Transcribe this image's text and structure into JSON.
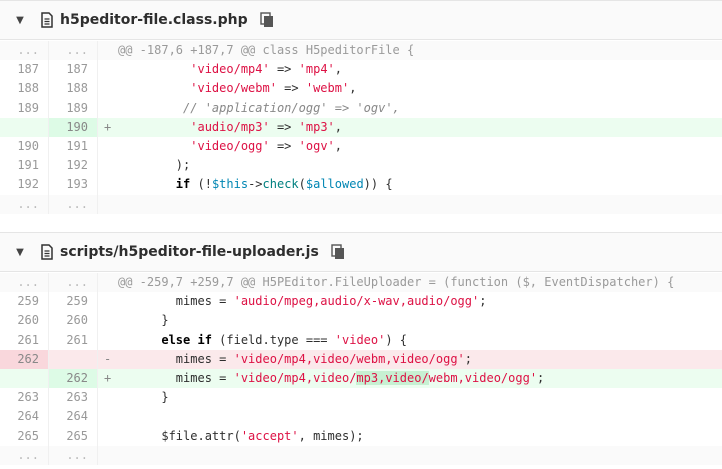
{
  "files": [
    {
      "name": "h5peditor-file.class.php",
      "hunk_header": "@@ -187,6 +187,7 @@ class H5peditorFile {",
      "lines": [
        {
          "type": "context",
          "old": "187",
          "new": "187",
          "sign": "",
          "tokens": [
            {
              "t": "          "
            },
            {
              "t": "'video/mp4'",
              "c": "s"
            },
            {
              "t": " => "
            },
            {
              "t": "'mp4'",
              "c": "s"
            },
            {
              "t": ","
            }
          ]
        },
        {
          "type": "context",
          "old": "188",
          "new": "188",
          "sign": "",
          "tokens": [
            {
              "t": "          "
            },
            {
              "t": "'video/webm'",
              "c": "s"
            },
            {
              "t": " => "
            },
            {
              "t": "'webm'",
              "c": "s"
            },
            {
              "t": ","
            }
          ]
        },
        {
          "type": "context",
          "old": "189",
          "new": "189",
          "sign": "",
          "tokens": [
            {
              "t": "         "
            },
            {
              "t": "// 'application/ogg' => 'ogv',",
              "c": "cm"
            }
          ]
        },
        {
          "type": "add",
          "old": "",
          "new": "190",
          "sign": "+",
          "tokens": [
            {
              "t": "          "
            },
            {
              "t": "'audio/mp3'",
              "c": "s"
            },
            {
              "t": " => "
            },
            {
              "t": "'mp3'",
              "c": "s"
            },
            {
              "t": ","
            }
          ]
        },
        {
          "type": "context",
          "old": "190",
          "new": "191",
          "sign": "",
          "tokens": [
            {
              "t": "          "
            },
            {
              "t": "'video/ogg'",
              "c": "s"
            },
            {
              "t": " => "
            },
            {
              "t": "'ogv'",
              "c": "s"
            },
            {
              "t": ","
            }
          ]
        },
        {
          "type": "context",
          "old": "191",
          "new": "192",
          "sign": "",
          "tokens": [
            {
              "t": "        );"
            }
          ]
        },
        {
          "type": "context",
          "old": "192",
          "new": "193",
          "sign": "",
          "tokens": [
            {
              "t": "        "
            },
            {
              "t": "if",
              "c": "kw"
            },
            {
              "t": " (!"
            },
            {
              "t": "$this",
              "c": "var"
            },
            {
              "t": "->"
            },
            {
              "t": "check",
              "c": "fn"
            },
            {
              "t": "("
            },
            {
              "t": "$allowed",
              "c": "var"
            },
            {
              "t": ")) {"
            }
          ]
        },
        {
          "type": "match",
          "old": "...",
          "new": "...",
          "sign": "",
          "tokens": [
            {
              "t": ""
            }
          ]
        }
      ]
    },
    {
      "name": "scripts/h5peditor-file-uploader.js",
      "hunk_header": "@@ -259,7 +259,7 @@ H5PEditor.FileUploader = (function ($, EventDispatcher) {",
      "lines": [
        {
          "type": "context",
          "old": "259",
          "new": "259",
          "sign": "",
          "tokens": [
            {
              "t": "        mimes = "
            },
            {
              "t": "'audio/mpeg,audio/x-wav,audio/ogg'",
              "c": "s"
            },
            {
              "t": ";"
            }
          ]
        },
        {
          "type": "context",
          "old": "260",
          "new": "260",
          "sign": "",
          "tokens": [
            {
              "t": "      }"
            }
          ]
        },
        {
          "type": "context",
          "old": "261",
          "new": "261",
          "sign": "",
          "tokens": [
            {
              "t": "      "
            },
            {
              "t": "else if",
              "c": "kw"
            },
            {
              "t": " (field.type === "
            },
            {
              "t": "'video'",
              "c": "s"
            },
            {
              "t": ") {"
            }
          ]
        },
        {
          "type": "del",
          "old": "262",
          "new": "",
          "sign": "-",
          "tokens": [
            {
              "t": "        mimes = "
            },
            {
              "t": "'video/mp4,video/webm,video/ogg'",
              "c": "s"
            },
            {
              "t": ";"
            }
          ]
        },
        {
          "type": "add",
          "old": "",
          "new": "262",
          "sign": "+",
          "tokens": [
            {
              "t": "        mimes = "
            },
            {
              "t": "'video/mp4,video/",
              "c": "s"
            },
            {
              "t": "mp3,video/",
              "c": "s hl-add"
            },
            {
              "t": "webm,video/ogg'",
              "c": "s"
            },
            {
              "t": ";"
            }
          ]
        },
        {
          "type": "context",
          "old": "263",
          "new": "263",
          "sign": "",
          "tokens": [
            {
              "t": "      }"
            }
          ]
        },
        {
          "type": "context",
          "old": "264",
          "new": "264",
          "sign": "",
          "tokens": [
            {
              "t": ""
            }
          ]
        },
        {
          "type": "context",
          "old": "265",
          "new": "265",
          "sign": "",
          "tokens": [
            {
              "t": "      $file.attr("
            },
            {
              "t": "'accept'",
              "c": "s"
            },
            {
              "t": ", mimes);"
            }
          ]
        },
        {
          "type": "match",
          "old": "...",
          "new": "...",
          "sign": "",
          "tokens": [
            {
              "t": ""
            }
          ]
        }
      ]
    }
  ]
}
